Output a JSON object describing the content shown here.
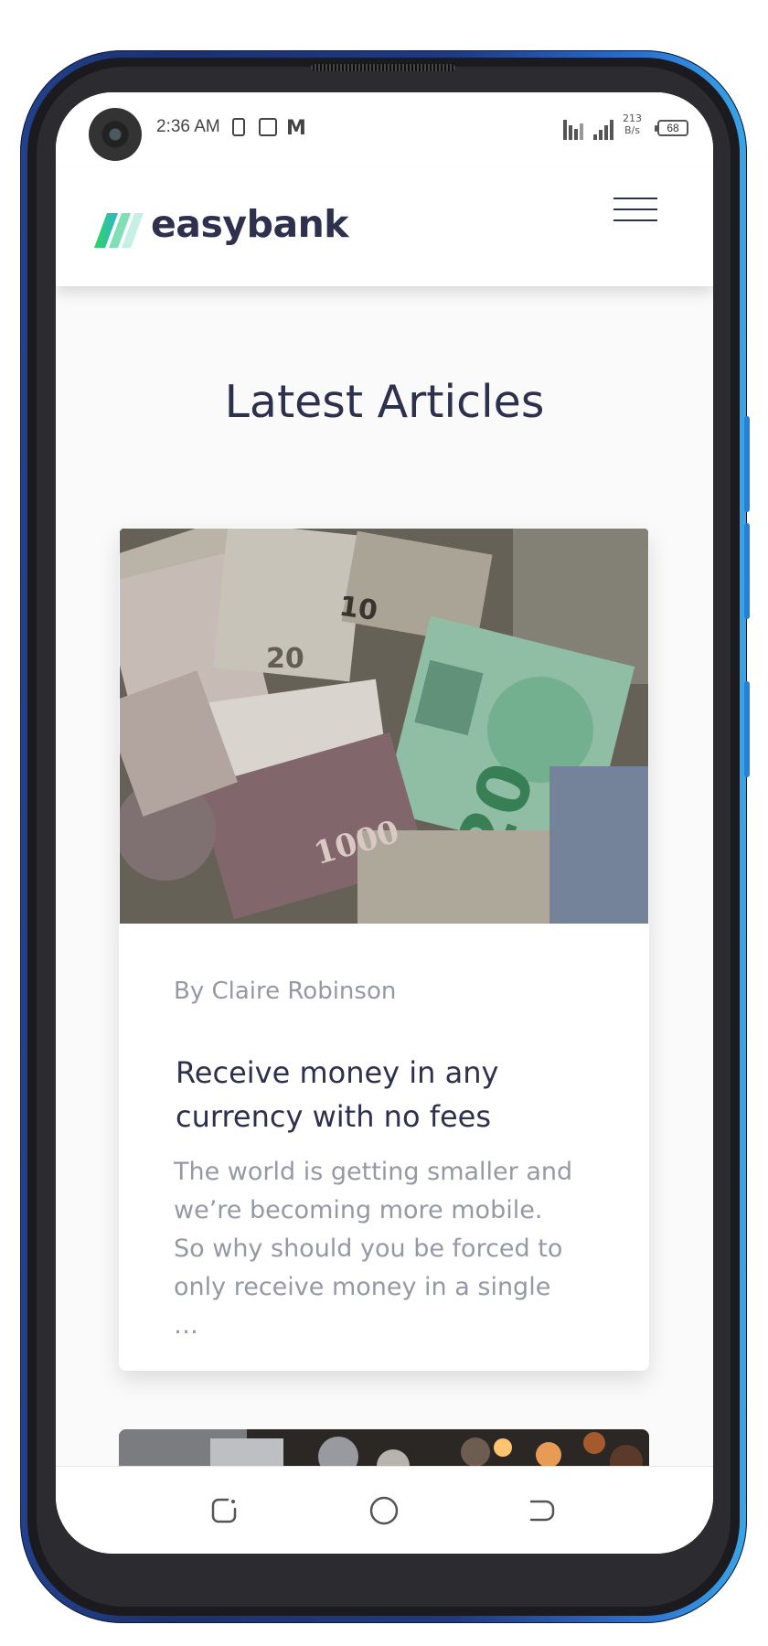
{
  "status_bar": {
    "time": "2:36 AM",
    "net_speed_value": "213",
    "net_speed_unit": "B/s",
    "battery": "68"
  },
  "header": {
    "logo_text": "easybank",
    "logo_colors": [
      "#33d35e",
      "#2ab7cd"
    ]
  },
  "section": {
    "title": "Latest Articles"
  },
  "articles": [
    {
      "author": "By Claire Robinson",
      "title": "Receive money in any currency with no fees",
      "excerpt": "The world is getting smaller and we’re becoming more mobile. So why should you be forced to only receive money in a single …"
    }
  ],
  "colors": {
    "dark_blue": "#2d314d",
    "grayish_blue": "#9698a6",
    "bg": "#fafafa",
    "phone_frame": "#1f3a82"
  },
  "nav": {
    "recent_icon": "recent-apps-icon",
    "home_icon": "home-icon",
    "back_icon": "back-icon"
  }
}
